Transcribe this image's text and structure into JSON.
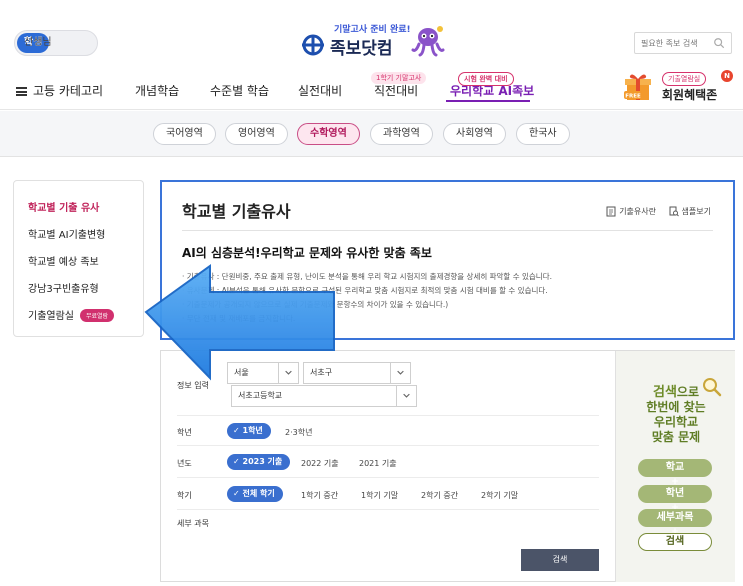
{
  "header": {
    "role_toggle": {
      "student": "학생",
      "teacher": "선생님"
    },
    "logo": {
      "tagline": "기말고사 준비 완료!",
      "name": "족보닷컴"
    },
    "search": {
      "placeholder": "필요한 족보 검색"
    },
    "nav": {
      "category": "고등 카테고리",
      "items": [
        {
          "label": "개념학습"
        },
        {
          "label": "수준별 학습"
        },
        {
          "label": "실전대비"
        },
        {
          "label": "직전대비",
          "badge": "1학기 기말고사"
        },
        {
          "label": "우리학교 AI족보",
          "badge": "시험 완벽 대비"
        }
      ]
    },
    "member": {
      "pill": "기출열람실",
      "new_badge": "N",
      "free": "FREE",
      "label": "회원혜택존"
    }
  },
  "subjects": [
    "국어영역",
    "영어영역",
    "수학영역",
    "과학영역",
    "사회영역",
    "한국사"
  ],
  "sidebar": {
    "items": [
      {
        "label": "학교별 기출 유사"
      },
      {
        "label": "학교별 AI기출변형"
      },
      {
        "label": "학교별 예상 족보"
      },
      {
        "label": "강남3구빈출유형"
      },
      {
        "label": "기출열람실",
        "badge": "무료열람"
      }
    ]
  },
  "main": {
    "title": "학교별 기출유사",
    "link_sample": "기출유사란",
    "link_view": "샘플보기",
    "subtitle": "AI의 심층분석!우리학교 문제와 유사한 맞춤 족보",
    "notes": [
      "· 기출유사 : 단원비중, 주요 출제 유형, 난이도 분석을 통해 우리 학교 시험지의 출제경향을 상세히 파악할 수 있습니다.",
      "· 유사문제 : AI분석을 통해 유사한 문항으로 구성된 우리학교 맞춤 시험지로 최적의 맞춤 시험 대비를 할 수 있습니다.",
      "· 기출문제가 공개되지 않으므로 실제 기출문제와 문항수의 차이가 있을 수 있습니다.)",
      "· 무단 전재 및 재배포를 금지합니다."
    ]
  },
  "form": {
    "info_label": "정보 입력",
    "region": "서울",
    "district": "서초구",
    "school": "서초고등학교",
    "grade_label": "학년",
    "grade_selected": "1학년",
    "grade_other": "2·3학년",
    "year_label": "년도",
    "year_selected": "2023 기출",
    "year_options": [
      "2022 기출",
      "2021 기출"
    ],
    "term_label": "학기",
    "term_selected": "전체 학기",
    "term_options": [
      "1학기 중간",
      "1학기 기말",
      "2학기 중간",
      "2학기 기말"
    ],
    "detail_label": "세부 과목",
    "search_button": "검색"
  },
  "promo": {
    "line1_b": "검색",
    "line1_r": "으로",
    "line2": "한번에 찾는",
    "line3": "우리학교",
    "line4": "맞춤 문제",
    "steps": [
      "학교",
      "학년",
      "세부과목",
      "검색"
    ]
  },
  "colors": {
    "accent": "#3a74d9",
    "brand_purple": "#7a1fb3",
    "pink": "#d6336c",
    "arrow": "#2f8be6",
    "olive": "#6e8c2a"
  }
}
